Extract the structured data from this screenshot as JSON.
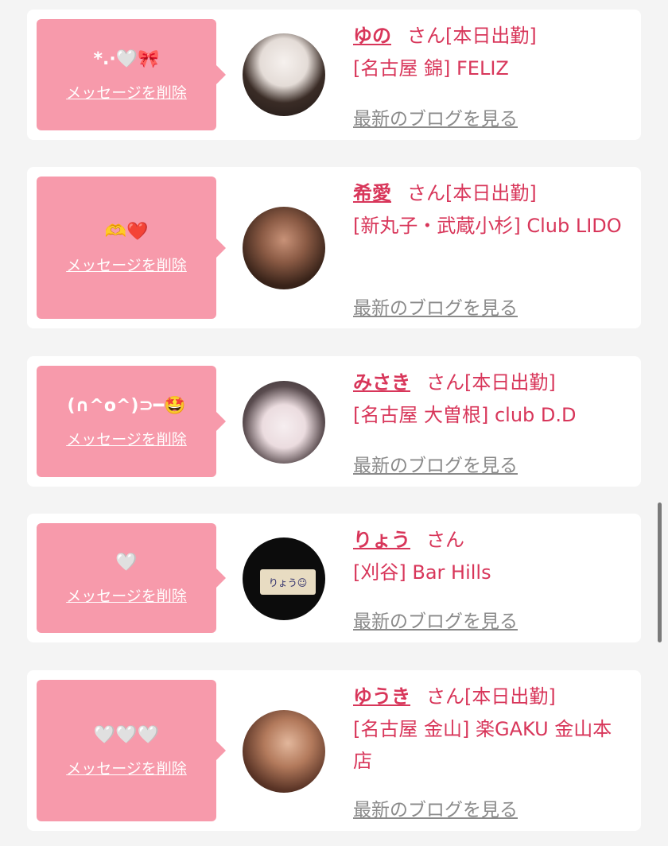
{
  "cards": [
    {
      "message": "*.·🤍🎀",
      "delete_label": "メッセージを削除",
      "name": "ゆの",
      "suffix": "さん",
      "status": "[本日出勤]",
      "shop": "[名古屋 錦] FELIZ",
      "blog_label": "最新のブログを見る",
      "avatar_colors": [
        "#e9e4df",
        "#2b211d"
      ]
    },
    {
      "message": "🫶❤️",
      "delete_label": "メッセージを削除",
      "name": "希愛",
      "suffix": "さん",
      "status": "[本日出勤]",
      "shop": "[新丸子・武蔵小杉] Club LIDO",
      "blog_label": "最新のブログを見る",
      "avatar_colors": [
        "#a0715a",
        "#2a1a14"
      ]
    },
    {
      "message": "(∩^o^)⊃━🤩",
      "delete_label": "メッセージを削除",
      "name": "みさき",
      "suffix": "さん",
      "status": "[本日出勤]",
      "shop": "[名古屋 大曽根] club D.D",
      "blog_label": "最新のブログを見る",
      "avatar_colors": [
        "#f3e9ea",
        "#6b5a5c"
      ]
    },
    {
      "message": "🤍",
      "delete_label": "メッセージを削除",
      "name": "りょう",
      "suffix": "さん",
      "status": "",
      "shop": "[刈谷] Bar Hills",
      "blog_label": "最新のブログを見る",
      "avatar_colors": [
        "#0c0c0c",
        "#e8dcc2"
      ],
      "avatar_text": "りょう☺"
    },
    {
      "message": "🤍🤍🤍",
      "delete_label": "メッセージを削除",
      "name": "ゆうき",
      "suffix": "さん",
      "status": "[本日出勤]",
      "shop": "[名古屋 金山] 楽GAKU 金山本店",
      "blog_label": "最新のブログを見る",
      "avatar_colors": [
        "#c08a6a",
        "#3a2218"
      ]
    }
  ],
  "colors": {
    "accent": "#d8365a",
    "bubble": "#f79aab",
    "link_gray": "#8a8a8a",
    "background": "#f4f4f4"
  }
}
